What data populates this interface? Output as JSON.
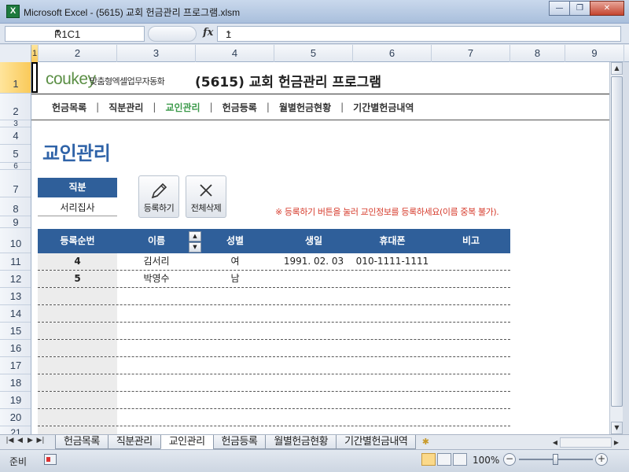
{
  "window": {
    "title": "Microsoft Excel - (5615) 교회 헌금관리 프로그램.xlsm",
    "app_icon_letter": "X",
    "minimize": "—",
    "restore": "❐",
    "close": "✕"
  },
  "formula_bar": {
    "name_box": "R1C1",
    "fx": "fx",
    "value": "1"
  },
  "columns": [
    "1",
    "2",
    "3",
    "4",
    "5",
    "6",
    "7",
    "8",
    "9"
  ],
  "rows": [
    "1",
    "2",
    "3",
    "4",
    "5",
    "6",
    "7",
    "8",
    "9",
    "10",
    "11",
    "12",
    "13",
    "14",
    "15",
    "16",
    "17",
    "18",
    "19",
    "20",
    "21"
  ],
  "header": {
    "logo": "coukey",
    "logo_sub": "맞춤형엑셀업무자동화",
    "app_title": "(5615) 교회 헌금관리 프로그램"
  },
  "nav": {
    "items": [
      "헌금목록",
      "직분관리",
      "교인관리",
      "헌금등록",
      "월별헌금현황",
      "기간별헌금내역"
    ],
    "active": "교인관리",
    "separator": "|"
  },
  "page_title": "교인관리",
  "role": {
    "header": "직분",
    "value": "서리집사"
  },
  "buttons": {
    "register": "등록하기",
    "delete_all": "전체삭제"
  },
  "notice": "※ 등록하기 버튼을 눌러 교인정보를 등록하세요(이름 중복 불가).",
  "table": {
    "headers": [
      "등록순번",
      "이름",
      "성별",
      "생일",
      "휴대폰",
      "비고"
    ],
    "rows": [
      [
        "4",
        "김서리",
        "여",
        "1991. 02. 03",
        "010-1111-1111",
        ""
      ],
      [
        "5",
        "박영수",
        "남",
        "",
        "",
        ""
      ]
    ]
  },
  "sheet_tabs": [
    "헌금목록",
    "직분관리",
    "교인관리",
    "헌금등록",
    "월별헌금현황",
    "기간별헌금내역"
  ],
  "active_tab": "교인관리",
  "status": {
    "mode": "준비",
    "zoom": "100%"
  }
}
